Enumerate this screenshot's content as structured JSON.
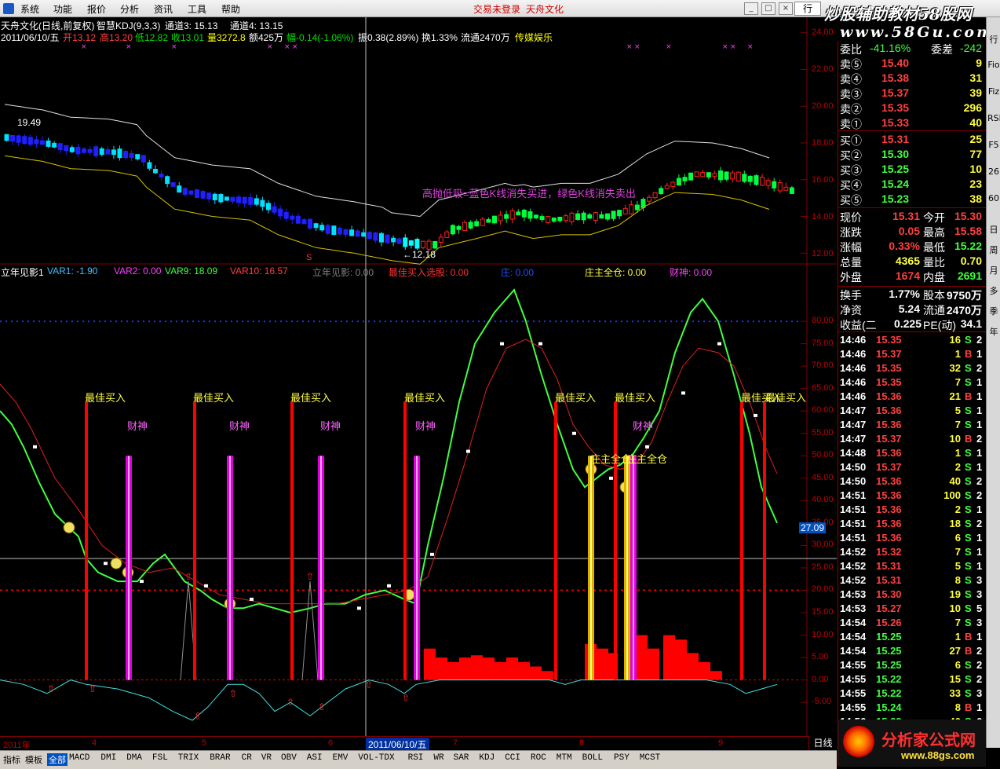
{
  "menu": {
    "items": [
      "系统",
      "功能",
      "报价",
      "分析",
      "资讯",
      "工具",
      "帮助"
    ],
    "login_status": "交易未登录",
    "broker": "天舟文化",
    "quote_button": "行"
  },
  "watermark": {
    "title": "炒股辅助教材58股网",
    "url": "www.58Gu.com",
    "bottom": "分析家公式网",
    "bottom_url": "www.88gs.com"
  },
  "kline_header": {
    "stock": "天舟文化(日线,前复权)",
    "indicator": "智慧KDJ(9,3,3)",
    "channel3": "通道3: 15.13",
    "channel4": "通道4: 13.15",
    "date": "2011/06/10/五",
    "open": "开13.12",
    "high": "高13.20",
    "low": "低12.82",
    "close": "收13.01",
    "volume": "量3272.8",
    "amount": "额425万",
    "change": "幅-0.14(-1.06%)",
    "amplitude": "振0.38(2.89%)",
    "turnover": "换1.33%",
    "float": "流通2470万",
    "sector": "传媒娱乐"
  },
  "kline_annotations": {
    "max_label": "19.49",
    "min_label": "←12.18",
    "tip": "高抛低吸=蓝色K线消失买进，绿色K线消失卖出",
    "s_mark": "S"
  },
  "price_axis": [
    "24.00",
    "22.00",
    "20.00",
    "18.00",
    "16.00",
    "14.00",
    "12.00"
  ],
  "indicator_header": {
    "name": "立年见影1",
    "var1": "VAR1: -1.90",
    "var2": "VAR2: 0.00",
    "var9": "VAR9: 18.09",
    "var10": "VAR10: 16.57",
    "ly": "立年见影: 0.00",
    "best": "最佳买入选股: 0.00",
    "mid": "庄: 0.00",
    "full": "庄主全仓: 0.00",
    "wealth": "财神: 0.00"
  },
  "indicator_axis": [
    "80.00",
    "75.00",
    "70.00",
    "65.00",
    "60.00",
    "55.00",
    "50.00",
    "45.00",
    "40.00",
    "35.00",
    "30.00",
    "25.00",
    "20.00",
    "15.00",
    "10.00",
    "5.00",
    "0.00",
    "-5.00"
  ],
  "indicator_value": "27.09",
  "signals": {
    "best_buy": "最佳买入",
    "wealth": "财神",
    "full": "庄主全仓"
  },
  "chart_data": {
    "type": "candlestick",
    "price_ylim": [
      11.5,
      24.5
    ],
    "indicator_ylim": [
      -9,
      90
    ]
  },
  "orderbook": {
    "change_label": "委比",
    "change_value": "-41.16%",
    "diff_label": "委差",
    "diff_value": "-242",
    "asks": [
      {
        "l": "卖⑤",
        "p": "15.40",
        "v": "9"
      },
      {
        "l": "卖④",
        "p": "15.38",
        "v": "31"
      },
      {
        "l": "卖③",
        "p": "15.37",
        "v": "39"
      },
      {
        "l": "卖②",
        "p": "15.35",
        "v": "296"
      },
      {
        "l": "卖①",
        "p": "15.33",
        "v": "40"
      }
    ],
    "bids": [
      {
        "l": "买①",
        "p": "15.31",
        "v": "25"
      },
      {
        "l": "买②",
        "p": "15.30",
        "v": "77"
      },
      {
        "l": "买③",
        "p": "15.25",
        "v": "10"
      },
      {
        "l": "买④",
        "p": "15.24",
        "v": "23"
      },
      {
        "l": "买⑤",
        "p": "15.23",
        "v": "38"
      }
    ]
  },
  "quote": [
    {
      "l1": "现价",
      "v1": "15.31",
      "l2": "今开",
      "v2": "15.30"
    },
    {
      "l1": "涨跌",
      "v1": "0.05",
      "l2": "最高",
      "v2": "15.58"
    },
    {
      "l1": "涨幅",
      "v1": "0.33%",
      "l2": "最低",
      "v2": "15.22"
    },
    {
      "l1": "总量",
      "v1": "4365",
      "l2": "量比",
      "v2": "0.70"
    },
    {
      "l1": "外盘",
      "v1": "1674",
      "l2": "内盘",
      "v2": "2691"
    },
    {
      "l1": "换手",
      "v1": "1.77%",
      "l2": "股本",
      "v2": "9750万"
    },
    {
      "l1": "净资",
      "v1": "5.24",
      "l2": "流通",
      "v2": "2470万"
    },
    {
      "l1": "收益(二",
      "v1": "0.225",
      "l2": "PE(动)",
      "v2": "34.1"
    }
  ],
  "ticks": [
    [
      "14:46",
      "15.35",
      "16",
      "S",
      "2"
    ],
    [
      "14:46",
      "15.37",
      "1",
      "B",
      "1"
    ],
    [
      "14:46",
      "15.35",
      "32",
      "S",
      "2"
    ],
    [
      "14:46",
      "15.35",
      "7",
      "S",
      "1"
    ],
    [
      "14:46",
      "15.36",
      "21",
      "B",
      "1"
    ],
    [
      "14:47",
      "15.36",
      "5",
      "S",
      "1"
    ],
    [
      "14:47",
      "15.36",
      "7",
      "S",
      "1"
    ],
    [
      "14:47",
      "15.37",
      "10",
      "B",
      "2"
    ],
    [
      "14:48",
      "15.36",
      "1",
      "S",
      "1"
    ],
    [
      "14:50",
      "15.37",
      "2",
      "S",
      "1"
    ],
    [
      "14:50",
      "15.36",
      "40",
      "S",
      "2"
    ],
    [
      "14:51",
      "15.36",
      "100",
      "S",
      "2"
    ],
    [
      "14:51",
      "15.36",
      "2",
      "S",
      "1"
    ],
    [
      "14:51",
      "15.36",
      "18",
      "S",
      "2"
    ],
    [
      "14:51",
      "15.36",
      "6",
      "S",
      "1"
    ],
    [
      "14:52",
      "15.32",
      "7",
      "S",
      "1"
    ],
    [
      "14:52",
      "15.31",
      "5",
      "S",
      "1"
    ],
    [
      "14:52",
      "15.31",
      "8",
      "S",
      "3"
    ],
    [
      "14:53",
      "15.30",
      "19",
      "S",
      "3"
    ],
    [
      "14:53",
      "15.27",
      "10",
      "S",
      "5"
    ],
    [
      "14:54",
      "15.26",
      "7",
      "S",
      "3"
    ],
    [
      "14:54",
      "15.25",
      "1",
      "B",
      "1"
    ],
    [
      "14:54",
      "15.25",
      "27",
      "B",
      "2"
    ],
    [
      "14:55",
      "15.25",
      "6",
      "S",
      "2"
    ],
    [
      "14:55",
      "15.22",
      "15",
      "S",
      "2"
    ],
    [
      "14:55",
      "15.22",
      "33",
      "S",
      "3"
    ],
    [
      "14:55",
      "15.24",
      "8",
      "B",
      "1"
    ],
    [
      "14:56",
      "15.22",
      "40",
      "S",
      "6"
    ]
  ],
  "datebar": {
    "year": "2011年",
    "m4": "4",
    "m5": "5",
    "m6": "6",
    "cursor": "2011/06/10/五",
    "m7": "7",
    "m8": "8",
    "m9": "9",
    "period": "日线"
  },
  "tabs": [
    "指标",
    "模板",
    "全部",
    "MACD",
    "DMI",
    "DMA",
    "FSL",
    "TRIX",
    "BRAR",
    "CR",
    "VR",
    "OBV",
    "ASI",
    "EMV",
    "VOL-TDX",
    "RSI",
    "WR",
    "SAR",
    "KDJ",
    "CCI",
    "ROC",
    "MTM",
    "BOLL",
    "PSY",
    "MCST"
  ],
  "sidebar": [
    "行",
    "Fio",
    "Fiz",
    "RSI",
    "F5",
    "26",
    "60",
    "日",
    "周",
    "月",
    "多",
    "季",
    "年"
  ]
}
